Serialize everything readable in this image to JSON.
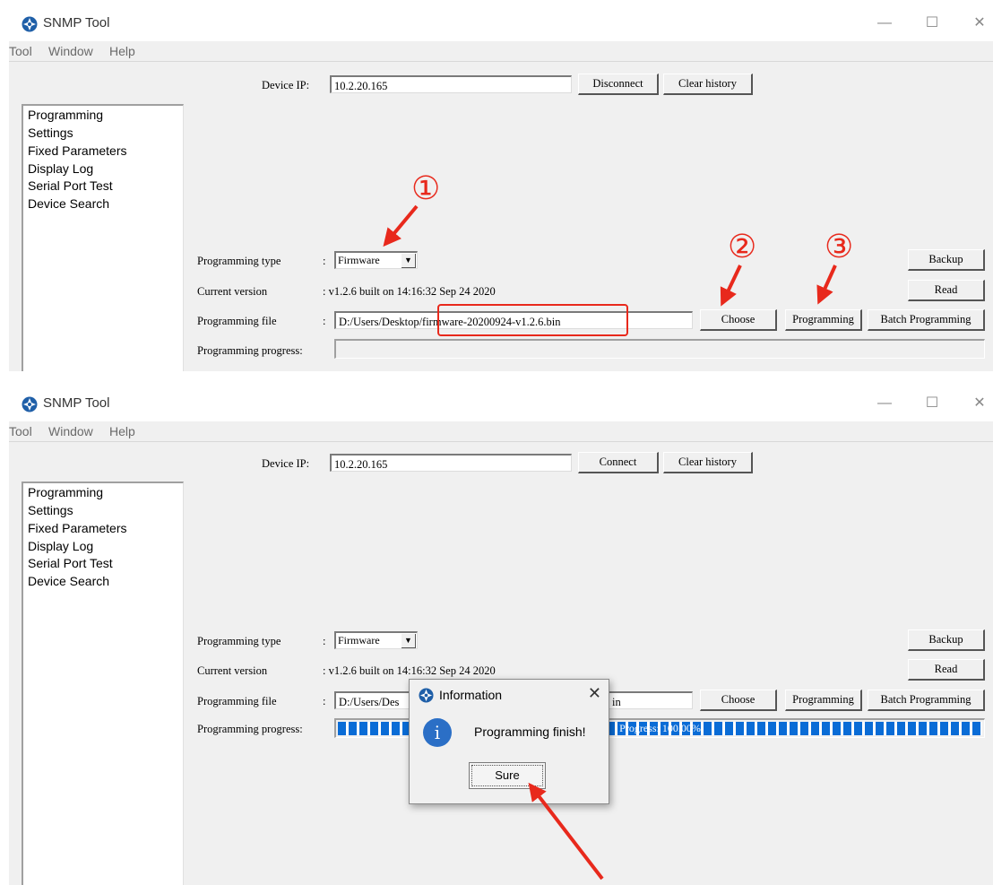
{
  "app": {
    "title": "SNMP Tool"
  },
  "window_controls": {
    "minimize": "—",
    "maximize": "☐",
    "close": "✕"
  },
  "menu": [
    "Tool",
    "Window",
    "Help"
  ],
  "sidebar": {
    "items": [
      "Programming",
      "Settings",
      "Fixed Parameters",
      "Display Log",
      "Serial Port Test",
      "Device Search"
    ]
  },
  "labels": {
    "device_ip": "Device IP:",
    "programming_type": "Programming type",
    "current_version": "Current version",
    "programming_file": "Programming file",
    "programming_progress": "Programming progress:",
    "colon": ":"
  },
  "buttons": {
    "disconnect": "Disconnect",
    "connect": "Connect",
    "clear_history": "Clear history",
    "backup": "Backup",
    "read": "Read",
    "choose": "Choose",
    "programming": "Programming",
    "batch_programming": "Batch Programming"
  },
  "panel1": {
    "device_ip": "10.2.20.165",
    "programming_type": "Firmware",
    "current_version": ": v1.2.6 built on 14:16:32 Sep 24 2020",
    "programming_file": "D:/Users/Desktop/firmware-20200924-v1.2.6.bin",
    "progress": 0
  },
  "panel2": {
    "device_ip": "10.2.20.165",
    "programming_type": "Firmware",
    "current_version": ": v1.2.6 built on 14:16:32 Sep 24 2020",
    "programming_file_start": "D:/Users/Des",
    "programming_file_end": "in",
    "progress": 1.0,
    "progress_text": "Progress: 100.00%"
  },
  "dialog": {
    "title": "Information",
    "message": "Programming finish!",
    "button": "Sure",
    "close": "✕"
  },
  "annotations": {
    "step1": "①",
    "step2": "②",
    "step3": "③",
    "color": "#e8291c"
  },
  "colors": {
    "progress_fill": "#0a6cd6",
    "window_bg": "#f0f0f0",
    "info_icon": "#2b6fc6"
  }
}
